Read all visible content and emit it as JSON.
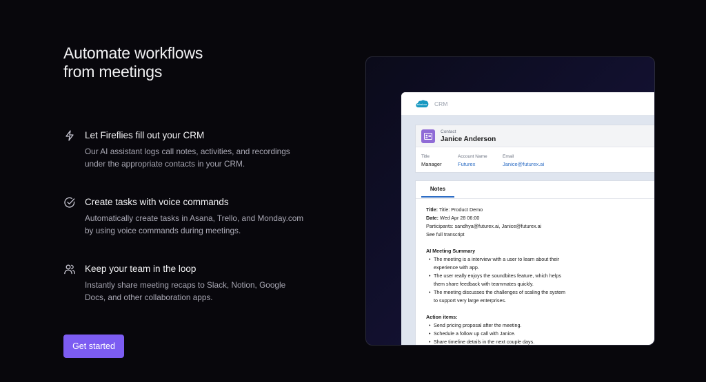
{
  "headline": {
    "line1": "Automate workflows",
    "line2": "from meetings"
  },
  "features": [
    {
      "icon": "lightning-icon",
      "title": "Let Fireflies fill out your CRM",
      "desc_line1": "Our AI assistant logs call notes, activities, and recordings",
      "desc_line2": "under the appropriate contacts in your CRM."
    },
    {
      "icon": "check-circle-icon",
      "title": "Create tasks with voice commands",
      "desc_line1": "Automatically create tasks in Asana, Trello, and Monday.com",
      "desc_line2": "by using voice commands during meetings."
    },
    {
      "icon": "users-icon",
      "title": "Keep your team in the loop",
      "desc_line1": "Instantly share meeting recaps to Slack, Notion, Google",
      "desc_line2": "Docs, and other collaboration apps."
    }
  ],
  "cta": {
    "label": "Get started"
  },
  "colors": {
    "accent": "#7c5cf2",
    "background": "#08070c"
  },
  "crm": {
    "app_label": "CRM",
    "contact": {
      "label": "Contact",
      "name": "Janice Anderson",
      "title_label": "Title",
      "title_value": "Manager",
      "account_label": "Account Name",
      "account_value": "Futurex",
      "email_label": "Email",
      "email_value": "Janice@futurex.ai"
    },
    "notes": {
      "tab": "Notes",
      "title_label": "Title:",
      "title_value": "Title: Product Demo",
      "date_label": "Date:",
      "date_value": "Wed Apr 28 06:00",
      "participants_label": "Participants:",
      "participants_value": "sandhya@futurex.ai, Janice@futurex.ai",
      "transcript_link": "See full transcript",
      "summary_heading": "AI Meeting Summary",
      "summary": [
        {
          "l1": "The meeting is a interview with a user to learn about their",
          "l2": "experience with app."
        },
        {
          "l1": "The user really enjoys the soundbites feature, which helps",
          "l2": "them share feedback with teammates quickly."
        },
        {
          "l1": "The meeting discusses the challenges of scaling the system",
          "l2": "to support very large enterprises."
        }
      ],
      "action_heading": "Action items:",
      "actions": [
        "Send pricing proposal after the meeting.",
        "Schedule a follow up call with Janice.",
        "Share timeline details in the next couple days."
      ]
    }
  }
}
